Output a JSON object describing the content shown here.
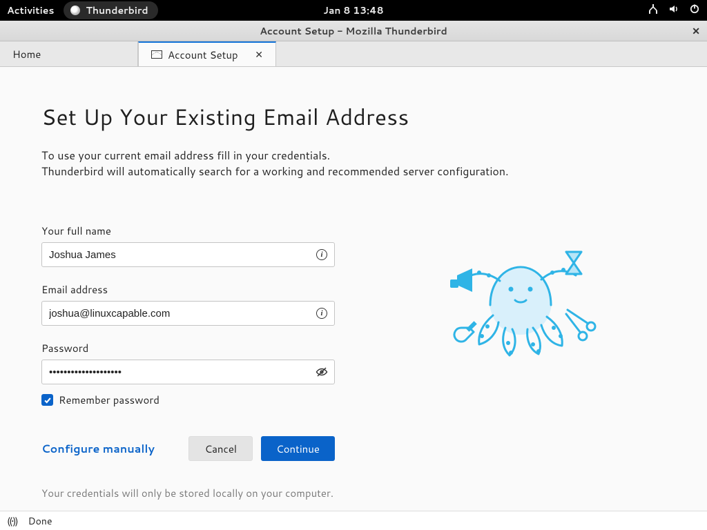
{
  "topbar": {
    "activities": "Activities",
    "app_name": "Thunderbird",
    "clock": "Jan 8  13:48"
  },
  "titlebar": {
    "title": "Account Setup - Mozilla Thunderbird"
  },
  "tabs": {
    "home": "Home",
    "setup": "Account Setup"
  },
  "page": {
    "heading": "Set Up Your Existing Email Address",
    "subtitle_line1": "To use your current email address fill in your credentials.",
    "subtitle_line2": "Thunderbird will automatically search for a working and recommended server configuration."
  },
  "form": {
    "fullname_label": "Your full name",
    "fullname_value": "Joshua James",
    "email_label": "Email address",
    "email_value": "joshua@linuxcapable.com",
    "password_label": "Password",
    "password_value": "aaaaaaaaaaaaaaaaaaaa",
    "remember_label": "Remember password",
    "remember_checked": true
  },
  "buttons": {
    "configure_label": "Configure manually",
    "cancel_label": "Cancel",
    "continue_label": "Continue"
  },
  "footnote": "Your credentials will only be stored locally on your computer.",
  "statusbar": {
    "text": "Done"
  }
}
